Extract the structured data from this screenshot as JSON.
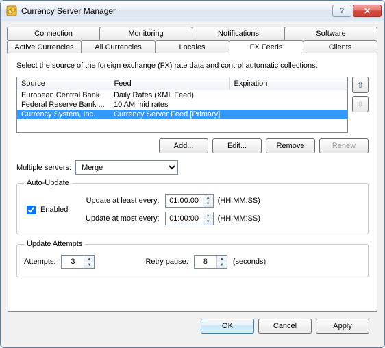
{
  "window": {
    "title": "Currency Server Manager"
  },
  "tabs": {
    "top": [
      "Connection",
      "Monitoring",
      "Notifications",
      "Software"
    ],
    "bottom": [
      "Active Currencies",
      "All Currencies",
      "Locales",
      "FX Feeds",
      "Clients"
    ],
    "active": "FX Feeds"
  },
  "page": {
    "description": "Select the source of the foreign exchange (FX) rate data and control automatic collections."
  },
  "feedsTable": {
    "columns": [
      "Source",
      "Feed",
      "Expiration"
    ],
    "rows": [
      {
        "source": "European Central Bank",
        "feed": "Daily Rates (XML Feed)",
        "expiration": ""
      },
      {
        "source": "Federal Reserve Bank ...",
        "feed": "10 AM mid rates",
        "expiration": ""
      },
      {
        "source": "Currency System, Inc.",
        "feed": "Currency Server Feed [Primary]",
        "expiration": ""
      }
    ],
    "selectedIndex": 2
  },
  "feedButtons": {
    "add": "Add...",
    "edit": "Edit...",
    "remove": "Remove",
    "renew": "Renew"
  },
  "multipleServers": {
    "label": "Multiple servers:",
    "options": [
      "Merge"
    ],
    "value": "Merge"
  },
  "autoUpdate": {
    "legend": "Auto-Update",
    "enabled_label": "Enabled",
    "enabled": true,
    "least_label": "Update at least every:",
    "least_value": "01:00:00",
    "most_label": "Update at most every:",
    "most_value": "01:00:00",
    "unit": "(HH:MM:SS)"
  },
  "updateAttempts": {
    "legend": "Update Attempts",
    "attempts_label": "Attempts:",
    "attempts_value": "3",
    "retry_label": "Retry pause:",
    "retry_value": "8",
    "retry_unit": "(seconds)"
  },
  "dialogButtons": {
    "ok": "OK",
    "cancel": "Cancel",
    "apply": "Apply"
  }
}
